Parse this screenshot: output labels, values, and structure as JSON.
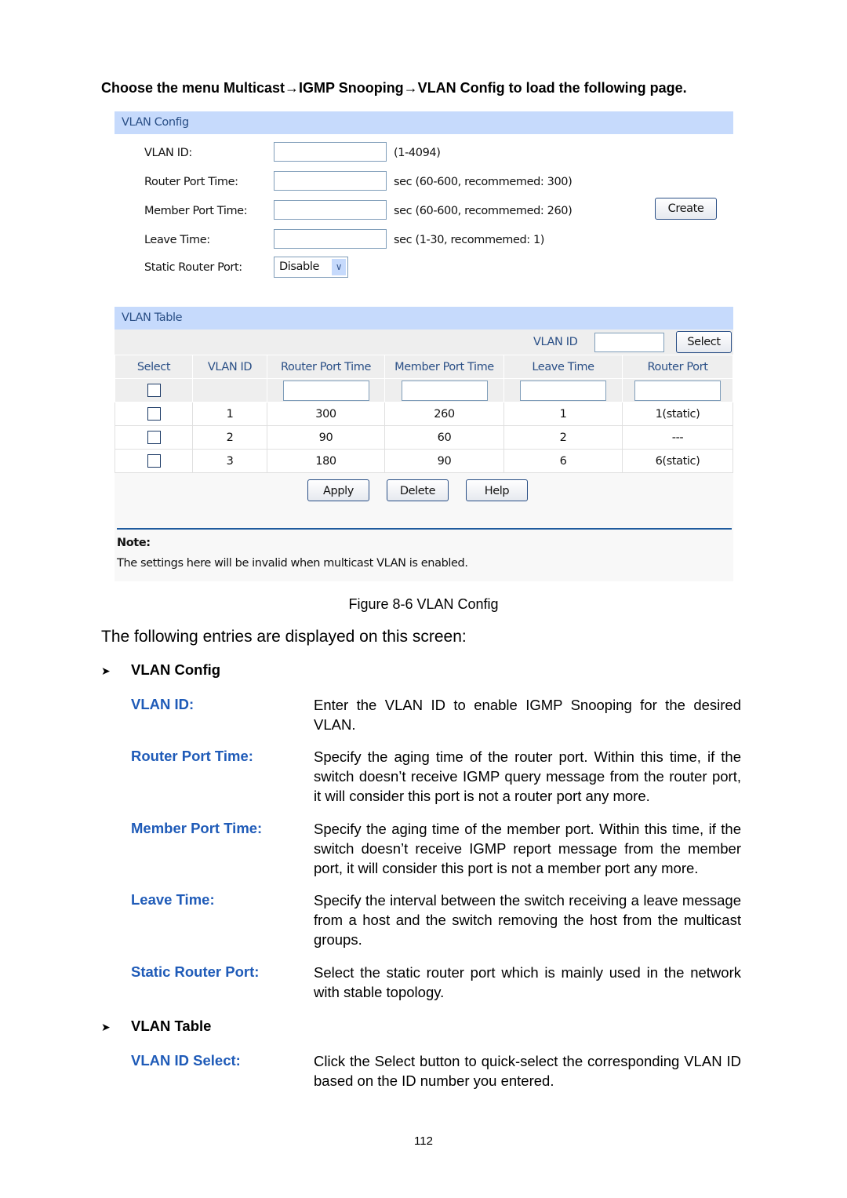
{
  "intro": "Choose the menu Multicast→IGMP Snooping→VLAN Config to load the following page.",
  "vlan_config": {
    "title": "VLAN Config",
    "fields": [
      {
        "label": "VLAN ID:",
        "value": "",
        "hint": "(1-4094)"
      },
      {
        "label": "Router Port Time:",
        "value": "",
        "hint": "sec (60-600, recommemed: 300)"
      },
      {
        "label": "Member Port Time:",
        "value": "",
        "hint": "sec (60-600, recommemed: 260)"
      },
      {
        "label": "Leave Time:",
        "value": "",
        "hint": "sec (1-30, recommemed: 1)"
      }
    ],
    "static_router_port": {
      "label": "Static Router Port:",
      "selected": "Disable"
    },
    "create_label": "Create"
  },
  "vlan_table": {
    "title": "VLAN Table",
    "search_label": "VLAN ID",
    "search_value": "",
    "select_label": "Select",
    "columns": [
      "Select",
      "VLAN ID",
      "Router Port Time",
      "Member Port Time",
      "Leave Time",
      "Router Port"
    ],
    "rows": [
      {
        "vlan": "1",
        "rpt": "300",
        "mpt": "260",
        "leave": "1",
        "router_port": "1(static)"
      },
      {
        "vlan": "2",
        "rpt": "90",
        "mpt": "60",
        "leave": "2",
        "router_port": "---"
      },
      {
        "vlan": "3",
        "rpt": "180",
        "mpt": "90",
        "leave": "6",
        "router_port": "6(static)"
      }
    ],
    "apply_label": "Apply",
    "delete_label": "Delete",
    "help_label": "Help"
  },
  "note": {
    "title": "Note:",
    "text": "The settings here will be invalid when multicast VLAN is enabled."
  },
  "caption": "Figure 8-6 VLAN Config",
  "lead": "The following entries are displayed on this screen:",
  "sections": [
    {
      "title": "VLAN Config",
      "items": [
        {
          "term": "VLAN ID:",
          "desc": "Enter the VLAN ID to enable IGMP Snooping for the desired VLAN."
        },
        {
          "term": "Router Port Time:",
          "desc": "Specify the aging time of the router port. Within this time, if the switch doesn’t receive IGMP query message from the router port, it will consider this port is not a router port any more."
        },
        {
          "term": "Member Port Time:",
          "desc": "Specify the aging time of the member port. Within this time, if the switch doesn’t receive IGMP report message from the member port, it will consider this port is not a member port any more."
        },
        {
          "term": "Leave Time:",
          "desc": "Specify the interval between the switch receiving a leave message from a host and the switch removing the host from the multicast groups."
        },
        {
          "term": "Static Router Port:",
          "desc": "Select the static router port which is mainly used in the network with stable topology."
        }
      ]
    },
    {
      "title": "VLAN Table",
      "items": [
        {
          "term": "VLAN ID Select:",
          "desc": "Click the Select button to quick-select the corresponding VLAN ID based on the ID number you entered."
        }
      ]
    }
  ],
  "page_number": "112"
}
